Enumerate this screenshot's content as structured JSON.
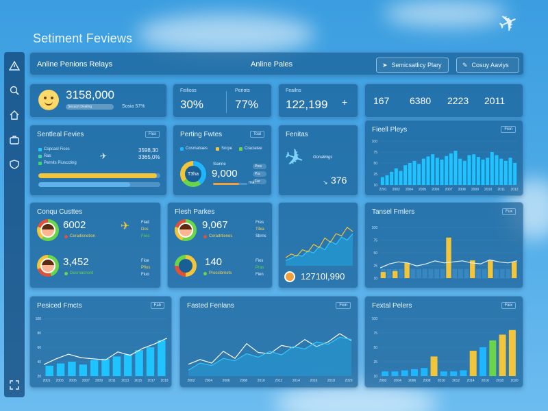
{
  "app": {
    "title": "Setiment Feviews"
  },
  "header": {
    "title": "Anline Penions Relays",
    "center": "Anline Pales",
    "buttons": [
      "Semicsatlicy Plary",
      "Cosuy Aaviys"
    ]
  },
  "sidebar": {
    "icons": [
      "alert-icon",
      "search-icon",
      "home-icon",
      "briefcase-icon",
      "shield-icon",
      "expand-icon"
    ]
  },
  "kpi_row": {
    "main": {
      "value": "3158,000",
      "pill": "Secucrt Dvaling",
      "percent": "Sosia 57%"
    },
    "two": {
      "label_a": "Feilioss",
      "value_a": "30%",
      "label_b": "Periots",
      "value_b": "77%"
    },
    "three": {
      "label": "Feailns",
      "value": "122,199",
      "plus": "+"
    },
    "four": [
      "167",
      "6380",
      "2223",
      "2011"
    ]
  },
  "sentiment_panel": {
    "title": "Sentleal Fevies",
    "tag": "Flux",
    "legend": [
      {
        "label": "Copcasl Fices",
        "color": "#21c6ff"
      },
      {
        "label": "Ras",
        "color": "#42d6a0"
      },
      {
        "label": "Pernits Piusccting",
        "color": "#3fd56b"
      }
    ],
    "nums": [
      "3598,30",
      "3365,0%"
    ],
    "bars": [
      0.97,
      0.75
    ]
  },
  "ranking_panel": {
    "title": "Perting Fwtes",
    "tag": "Toal",
    "legend": [
      "Cosmabaes",
      "Snrpe",
      "Craciatee"
    ],
    "donut_label": "T3ha",
    "subtitle": "Sianne",
    "value": "9,000",
    "unit": "ma",
    "side": [
      "Pres",
      "Pra",
      "Far"
    ]
  },
  "routes_panel": {
    "title": "Fenitas",
    "label": "Gonalinigs",
    "value": "376"
  },
  "trend_panel": {
    "title": "Fieell Pleys",
    "tag": "Fion",
    "yticks": [
      "100",
      "75",
      "50",
      "25",
      "10"
    ],
    "xticks": [
      "2201",
      "2002",
      "2004",
      "2005",
      "2006",
      "2007",
      "2008",
      "2009",
      "2010",
      "2011",
      "2012"
    ]
  },
  "countries_panel": {
    "title": "Conqu Custtes",
    "rows": [
      {
        "value": "6002",
        "label": "Ceradisnetion",
        "side": [
          "Fiad",
          "Dos",
          "Fixic"
        ]
      },
      {
        "value": "3,452",
        "label": "Desrnacnord",
        "side": [
          "Fioe",
          "Pfios",
          "Fiuo"
        ]
      }
    ]
  },
  "flight_panel": {
    "title": "Flesh Parkes",
    "rows": [
      {
        "value": "9,067",
        "label": "Ceradrtienes",
        "side": [
          "Fres",
          "Tibia",
          "Sbrns"
        ]
      },
      {
        "value": "140",
        "label": "Prossibrnets",
        "side": [
          "Fios",
          "Pras",
          "Fien"
        ]
      }
    ]
  },
  "mini_chart_panel": {
    "value": "12710l,990"
  },
  "tranel_panel": {
    "title": "Tansel Fmlers",
    "tag": "Fux",
    "yticks": [
      "100",
      "75",
      "50",
      "25",
      "10"
    ],
    "xticks": [
      "2002",
      "2004",
      "2006",
      "2008",
      "2010",
      "2012",
      "2014",
      "2016",
      "2018",
      "2020"
    ]
  },
  "posted_panel": {
    "title": "Pesiced Fmcts",
    "tag": "Fab",
    "yticks": [
      "100",
      "80",
      "60",
      "40",
      "20"
    ],
    "xticks": [
      "2001",
      "2003",
      "2005",
      "2007",
      "2009",
      "2011",
      "2013",
      "2015",
      "2017",
      "2019"
    ]
  },
  "section_panel": {
    "title": "Fasted Fenlans",
    "tag": "Fion",
    "xticks": [
      "2002",
      "2004",
      "2006",
      "2008",
      "2010",
      "2012",
      "2014",
      "2016",
      "2018",
      "2020"
    ]
  },
  "pedal_panel": {
    "title": "Fextal Pelers",
    "tag": "Fiex",
    "yticks": [
      "100",
      "75",
      "50",
      "25",
      "10"
    ],
    "xticks": [
      "2002",
      "2004",
      "2006",
      "2008",
      "2010",
      "2012",
      "2014",
      "2016",
      "2018",
      "2020"
    ]
  },
  "chart_data": [
    {
      "type": "bar",
      "chart": "trend",
      "x": [
        "2201",
        "2002",
        "2004",
        "2005",
        "2006",
        "2007",
        "2008",
        "2009",
        "2010",
        "2011",
        "2012"
      ],
      "values": [
        18,
        22,
        30,
        38,
        32,
        45,
        50,
        55,
        48,
        60,
        65,
        70,
        62,
        58,
        66,
        72,
        78,
        60,
        55,
        68,
        70,
        64,
        58,
        62,
        75,
        68,
        60,
        55,
        62,
        50
      ],
      "ylim": [
        0,
        100
      ]
    },
    {
      "type": "bar",
      "chart": "tranel",
      "values": [
        12,
        0,
        14,
        0,
        30,
        0,
        0,
        0,
        0,
        0,
        0,
        80,
        0,
        0,
        0,
        35,
        0,
        0,
        35,
        0,
        0,
        0,
        32
      ],
      "line": [
        20,
        28,
        32,
        30,
        24,
        28,
        34,
        30,
        32,
        34,
        30,
        28,
        36,
        32,
        30,
        34
      ],
      "ylim": [
        0,
        100
      ]
    },
    {
      "type": "bar",
      "chart": "posted",
      "values": [
        18,
        22,
        25,
        20,
        28,
        30,
        34,
        38,
        45,
        50,
        62
      ],
      "line": [
        20,
        30,
        38,
        32,
        30,
        28,
        42,
        36,
        48,
        56,
        66
      ],
      "ylim": [
        0,
        100
      ]
    },
    {
      "type": "line",
      "chart": "section",
      "series": [
        {
          "values": [
            20,
            28,
            22,
            42,
            30,
            55,
            40,
            38,
            52,
            48,
            62,
            50,
            58,
            72,
            60
          ]
        },
        {
          "values": [
            10,
            22,
            18,
            30,
            26,
            38,
            32,
            42,
            36,
            50,
            46,
            58,
            54,
            66,
            62
          ]
        }
      ],
      "ylim": [
        0,
        100
      ]
    },
    {
      "type": "bar",
      "chart": "pedal",
      "values": [
        8,
        8,
        10,
        12,
        14,
        34,
        8,
        8,
        10,
        44,
        50,
        62,
        72,
        80
      ],
      "colors": [
        "#20b6ff",
        "#20b6ff",
        "#20b6ff",
        "#20b6ff",
        "#20b6ff",
        "#f2c53a",
        "#20b6ff",
        "#20b6ff",
        "#20b6ff",
        "#f2c53a",
        "#20b6ff",
        "#6ad44a",
        "#f2c53a",
        "#f2c53a"
      ],
      "ylim": [
        0,
        100
      ]
    },
    {
      "type": "area",
      "chart": "mini",
      "series": [
        {
          "values": [
            15,
            22,
            18,
            30,
            26,
            40,
            34,
            52,
            44,
            60,
            56,
            72,
            64
          ]
        },
        {
          "values": [
            10,
            14,
            20,
            18,
            28,
            24,
            36,
            30,
            46,
            40,
            54,
            48,
            60
          ]
        }
      ],
      "ylim": [
        0,
        100
      ]
    }
  ]
}
